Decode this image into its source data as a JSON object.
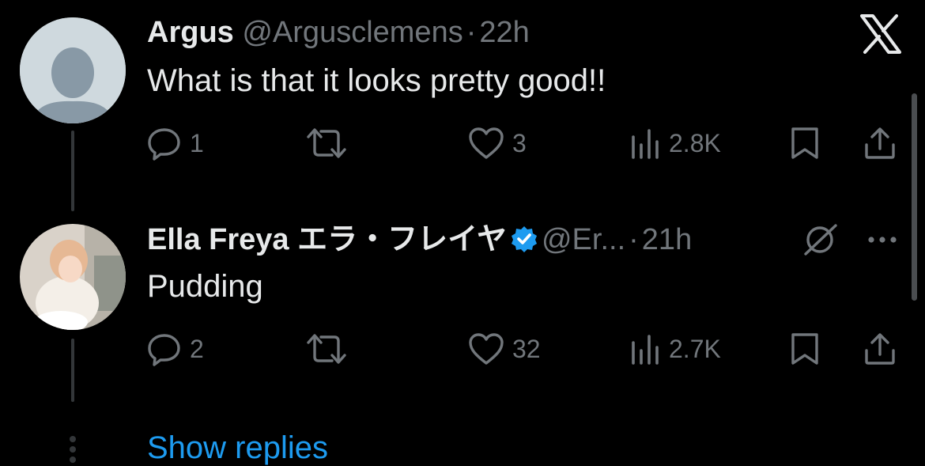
{
  "close_icon": "x-logo-icon",
  "tweets": [
    {
      "name": "Argus",
      "handle": "@Argusclemens",
      "separator": "·",
      "time": "22h",
      "text": "What is that it looks pretty good!!",
      "replies": "1",
      "likes": "3",
      "views": "2.8K"
    },
    {
      "name": "Ella Freya エラ・フレイヤ",
      "handle": "@Er...",
      "separator": "·",
      "time": "21h",
      "text": "Pudding",
      "replies": "2",
      "likes": "32",
      "views": "2.7K",
      "verified": true
    }
  ],
  "show_replies": "Show replies",
  "colors": {
    "background": "#000000",
    "text": "#e7e9ea",
    "muted": "#71767b",
    "link": "#1d9bf0",
    "verified": "#1d9bf0"
  }
}
